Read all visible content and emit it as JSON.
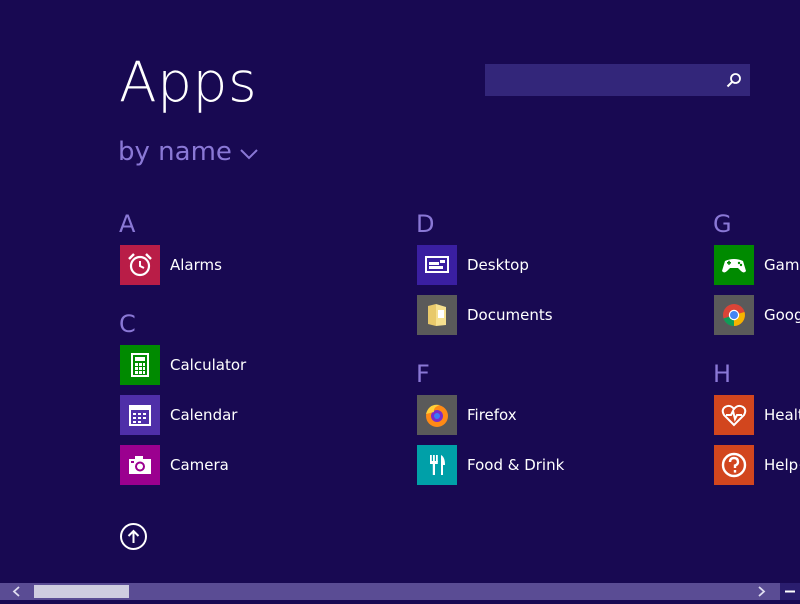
{
  "header": {
    "title": "Apps",
    "sort_label": "by name"
  },
  "search": {
    "value": "",
    "placeholder": ""
  },
  "groups": [
    {
      "letter": "A"
    },
    {
      "letter": "C"
    },
    {
      "letter": "D"
    },
    {
      "letter": "F"
    },
    {
      "letter": "G"
    },
    {
      "letter": "H"
    }
  ],
  "apps": [
    {
      "label": "Alarms",
      "icon": "alarm-clock-icon",
      "tile_color": "#b91d47"
    },
    {
      "label": "Calculator",
      "icon": "calculator-icon",
      "tile_color": "#008a00"
    },
    {
      "label": "Calendar",
      "icon": "calendar-icon",
      "tile_color": "#4f2fa8"
    },
    {
      "label": "Camera",
      "icon": "camera-icon",
      "tile_color": "#9b008f"
    },
    {
      "label": "Desktop",
      "icon": "desktop-icon",
      "tile_color": "#3a1fa1"
    },
    {
      "label": "Documents",
      "icon": "folder-icon",
      "tile_color": "#5a5a5a"
    },
    {
      "label": "Firefox",
      "icon": "firefox-icon",
      "tile_color": "#5a5a5a"
    },
    {
      "label": "Food & Drink",
      "icon": "fork-knife-icon",
      "tile_color": "#00a0a8"
    },
    {
      "label": "Game",
      "icon": "game-controller-icon",
      "tile_color": "#008a00"
    },
    {
      "label": "Goog",
      "icon": "chrome-icon",
      "tile_color": "#5a5a5a"
    },
    {
      "label": "Health",
      "icon": "heart-pulse-icon",
      "tile_color": "#d2461e"
    },
    {
      "label": "Help+",
      "icon": "question-icon",
      "tile_color": "#d2461e"
    }
  ],
  "colors": {
    "background": "#180952",
    "accent": "#8a78d6",
    "search_bg": "#33267a"
  },
  "scroll": {
    "position": 0.04
  }
}
